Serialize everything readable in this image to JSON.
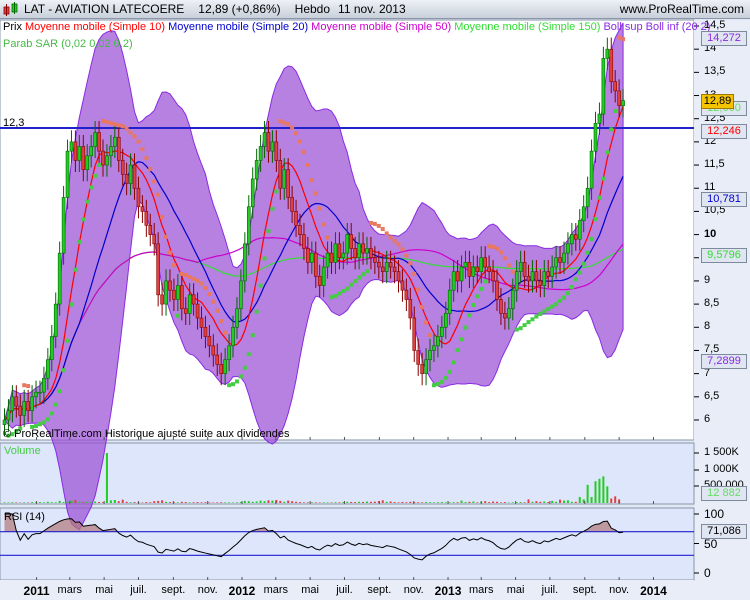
{
  "header": {
    "title": "LAT - AVIATION LATECOERE",
    "price": "12,89 (+0,86%)",
    "period": "Hebdo",
    "date": "11 nov. 2013",
    "site": "www.ProRealTime.com"
  },
  "legend": {
    "prix": "Prix",
    "ma10": "Moyenne mobile (Simple 10)",
    "ma20": "Moyenne mobile (Simple 20)",
    "ma50": "Moyenne mobile (Simple 50)",
    "ma150": "Moyenne mobile (Simple 150)",
    "boll": "Boll sup Boll inf (20 2)",
    "sar": "Parab SAR (0,02 0,02 0,2)"
  },
  "colors": {
    "ma10": "#ff0000",
    "ma20": "#0000cc",
    "ma50": "#cc00cc",
    "ma150": "#33dd33",
    "boll": "#8a2be2",
    "boll_fill": "#9a50d6",
    "sar": "#44cc44",
    "sar_down": "#e87860",
    "up": "#22cc22",
    "down": "#e04040",
    "hline": "#2020cc"
  },
  "hline": {
    "value": 12.3,
    "label": "12,3"
  },
  "copyright": "© ProRealTime.com Historique ajusté suite aux dividendes",
  "value_boxes": {
    "boll_sup": "14,272",
    "price": "12,89",
    "sar": "12,660",
    "ma10": "12,246",
    "ma20": "10,781",
    "ma150": "9,5796",
    "boll_inf": "7,2899",
    "volume": "12 882",
    "rsi": "71,086"
  },
  "chart_data": [
    {
      "type": "candlestick",
      "title": "LAT - AVIATION LATECOERE",
      "frequency": "weekly",
      "start": "2010-11-05",
      "ylim": [
        5.8,
        14.6
      ],
      "yticks": [
        "14,5",
        "14",
        "13,5",
        "13",
        "12,5",
        "12",
        "11,5",
        "11",
        "10,5",
        "10",
        "9,5",
        "9",
        "8,5",
        "8",
        "7,5",
        "7",
        "6,5",
        "6"
      ],
      "close": [
        6.0,
        6.2,
        6.5,
        6.3,
        6.1,
        6.4,
        6.2,
        6.5,
        6.6,
        6.6,
        6.9,
        7.3,
        7.8,
        8.5,
        9.6,
        10.8,
        11.8,
        12.0,
        11.6,
        11.9,
        11.4,
        11.7,
        11.9,
        12.2,
        11.8,
        11.5,
        11.7,
        11.9,
        12.1,
        11.6,
        11.3,
        11.1,
        11.5,
        11.0,
        10.6,
        10.5,
        10.2,
        10.0,
        9.8,
        8.7,
        8.5,
        9.0,
        8.8,
        8.6,
        8.9,
        8.4,
        8.3,
        8.7,
        8.5,
        8.2,
        8.0,
        7.8,
        7.6,
        7.4,
        7.2,
        7.0,
        7.3,
        7.6,
        8.0,
        8.4,
        9.0,
        9.8,
        10.6,
        11.2,
        11.6,
        11.9,
        12.2,
        11.8,
        12.0,
        11.6,
        11.0,
        11.4,
        10.8,
        10.5,
        10.2,
        10.0,
        9.7,
        9.4,
        9.6,
        9.1,
        8.9,
        9.3,
        9.6,
        9.4,
        9.8,
        9.5,
        9.6,
        10.0,
        9.7,
        9.5,
        9.8,
        9.6,
        9.7,
        9.5,
        9.4,
        9.3,
        9.2,
        9.4,
        9.3,
        9.2,
        9.0,
        8.8,
        8.6,
        8.2,
        7.5,
        7.2,
        7.0,
        7.3,
        7.5,
        7.6,
        7.8,
        8.0,
        8.3,
        8.8,
        9.2,
        9.0,
        9.3,
        9.4,
        9.1,
        9.3,
        9.2,
        9.5,
        9.3,
        9.2,
        9.0,
        8.6,
        8.3,
        8.2,
        8.4,
        8.8,
        9.2,
        9.4,
        9.1,
        9.0,
        9.2,
        9.0,
        8.9,
        9.2,
        9.1,
        9.3,
        9.5,
        9.4,
        9.6,
        9.8,
        10.0,
        9.9,
        10.3,
        10.6,
        11.0,
        11.8,
        12.4,
        12.6,
        13.8,
        14.0,
        13.3,
        13.1,
        12.78,
        12.89
      ],
      "indicators": [
        "SMA 10",
        "SMA 20",
        "SMA 50",
        "SMA 150",
        "Bollinger (20,2)",
        "Parabolic SAR (0.02,0.02,0.2)"
      ]
    },
    {
      "type": "bar",
      "title": "Volume",
      "unit": "K",
      "yticks": [
        "1 500K",
        "1 000K",
        "500 000"
      ],
      "ylim": [
        0,
        1700
      ],
      "values": [
        20,
        15,
        25,
        18,
        12,
        20,
        15,
        30,
        22,
        30,
        20,
        40,
        25,
        20,
        70,
        30,
        45,
        80,
        100,
        40,
        30,
        45,
        30,
        50,
        35,
        25,
        1650,
        90,
        100,
        60,
        110,
        40,
        25,
        30,
        20,
        15,
        30,
        25,
        60,
        70,
        90,
        40,
        30,
        25,
        20,
        40,
        30,
        20,
        25,
        30,
        20,
        25,
        20,
        15,
        20,
        25,
        20,
        20,
        15,
        20,
        30,
        70,
        60,
        40,
        50,
        80,
        60,
        90,
        80,
        100,
        70,
        40,
        80,
        60,
        40,
        30,
        20,
        20,
        25,
        20,
        15,
        20,
        20,
        15,
        25,
        20,
        30,
        40,
        35,
        30,
        40,
        35,
        50,
        40,
        45,
        60,
        90,
        40,
        50,
        30,
        20,
        35,
        25,
        40,
        30,
        25,
        20,
        30,
        25,
        20,
        25,
        30,
        20,
        20,
        25,
        25,
        80,
        30,
        40,
        50,
        20,
        40,
        60,
        30,
        50,
        40,
        20,
        30,
        15,
        20,
        25,
        30,
        20,
        120,
        40,
        60,
        40,
        50,
        30,
        70,
        40,
        110,
        80,
        90,
        40,
        40,
        200,
        120,
        600,
        200,
        720,
        800,
        880,
        550,
        150,
        220,
        120
      ],
      "last": "12 882"
    },
    {
      "type": "line",
      "title": "RSI (14)",
      "yticks": [
        "100",
        "50",
        "0"
      ],
      "ylim": [
        0,
        100
      ],
      "levels": [
        70,
        30
      ],
      "last": "71,086"
    }
  ],
  "xaxis": [
    {
      "label": "2011",
      "date": "2011-01-01",
      "year": true
    },
    {
      "label": "mars",
      "date": "2011-03-01"
    },
    {
      "label": "mai",
      "date": "2011-05-01"
    },
    {
      "label": "juil.",
      "date": "2011-07-01"
    },
    {
      "label": "sept.",
      "date": "2011-09-01"
    },
    {
      "label": "nov.",
      "date": "2011-11-01"
    },
    {
      "label": "2012",
      "date": "2012-01-01",
      "year": true
    },
    {
      "label": "mars",
      "date": "2012-03-01"
    },
    {
      "label": "mai",
      "date": "2012-05-01"
    },
    {
      "label": "juil.",
      "date": "2012-07-01"
    },
    {
      "label": "sept.",
      "date": "2012-09-01"
    },
    {
      "label": "nov.",
      "date": "2012-11-01"
    },
    {
      "label": "2013",
      "date": "2013-01-01",
      "year": true
    },
    {
      "label": "mars",
      "date": "2013-03-01"
    },
    {
      "label": "mai",
      "date": "2013-05-01"
    },
    {
      "label": "juil.",
      "date": "2013-07-01"
    },
    {
      "label": "sept.",
      "date": "2013-09-01"
    },
    {
      "label": "nov.",
      "date": "2013-11-01"
    },
    {
      "label": "2014",
      "date": "2014-01-01",
      "year": true
    }
  ]
}
